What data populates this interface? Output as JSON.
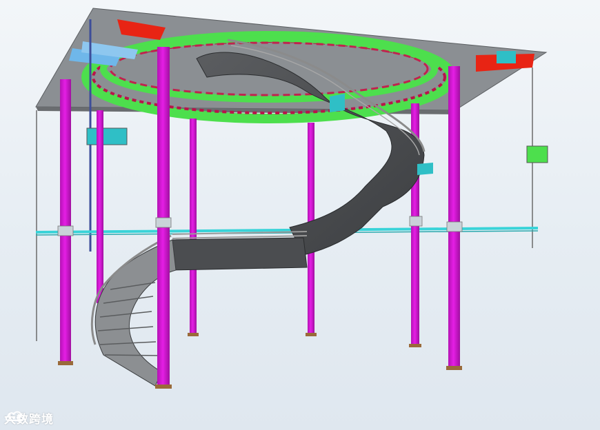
{
  "scene": {
    "kind": "3d-bim-model",
    "subject": "spiral-staircase-steel-structure",
    "colors": {
      "background_top": "#f3f6f9",
      "background_bottom": "#dfe7ef",
      "column": "#e51ee5",
      "column_dark": "#b413b4",
      "slab": "#8b8f93",
      "ring_beam": "#4ddf4d",
      "ring_inner": "#b9144a",
      "stair": "#4b4d50",
      "stair_light": "#8c8f92",
      "railing": "#8b8b8b",
      "cross_beam": "#39d3d8",
      "accent_red": "#e82414",
      "accent_blue": "#6fb7ea",
      "accent_cyan": "#2fbfc6"
    }
  },
  "watermark": {
    "text": "大数跨境",
    "logo_icon": "cloud-logo-icon"
  }
}
